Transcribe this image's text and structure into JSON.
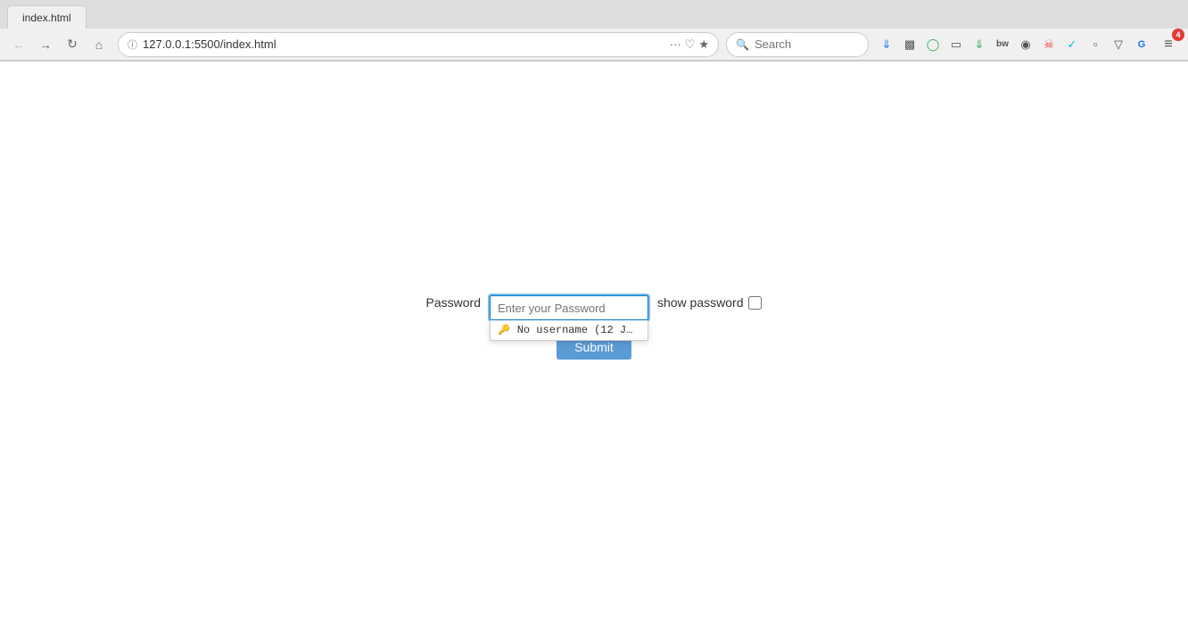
{
  "browser": {
    "tab_label": "index.html",
    "url": "127.0.0.1:5500/index.html",
    "url_full": "127.0.0.1:5500/index.html",
    "search_placeholder": "Search",
    "nav": {
      "back": "←",
      "forward": "→",
      "refresh": "↻",
      "home": "⌂"
    },
    "toolbar_icons": [
      {
        "name": "more-options",
        "symbol": "···",
        "color": "gray"
      },
      {
        "name": "pocket",
        "symbol": "♥",
        "color": "gray"
      },
      {
        "name": "bookmark",
        "symbol": "☆",
        "color": "gray"
      }
    ],
    "extension_icons": [
      {
        "name": "download-icon",
        "symbol": "↓",
        "color": "blue"
      },
      {
        "name": "library-icon",
        "symbol": "|||",
        "color": "gray"
      },
      {
        "name": "sync-icon",
        "symbol": "⟳",
        "color": "green"
      },
      {
        "name": "reader-icon",
        "symbol": "▭",
        "color": "gray"
      },
      {
        "name": "extension1-icon",
        "symbol": "↓",
        "color": "green"
      },
      {
        "name": "extension2-icon",
        "symbol": "BW",
        "color": "gray"
      },
      {
        "name": "extension3-icon",
        "symbol": "◉",
        "color": "gray"
      },
      {
        "name": "extension4-icon",
        "symbol": "⛨",
        "color": "red"
      },
      {
        "name": "extension5-icon",
        "symbol": "✓",
        "color": "cyan"
      },
      {
        "name": "extension6-icon",
        "symbol": "⬜",
        "color": "gray"
      },
      {
        "name": "extension7-icon",
        "symbol": "▽",
        "color": "gray"
      },
      {
        "name": "extension8-icon",
        "symbol": "G",
        "color": "blue"
      }
    ],
    "menu_icon": "≡",
    "notification_count": "4"
  },
  "form": {
    "password_label": "Password",
    "password_placeholder": "Enter your Password",
    "show_password_label": "show password",
    "submit_label": "Submit",
    "autocomplete_item": "No username (12 J…"
  }
}
